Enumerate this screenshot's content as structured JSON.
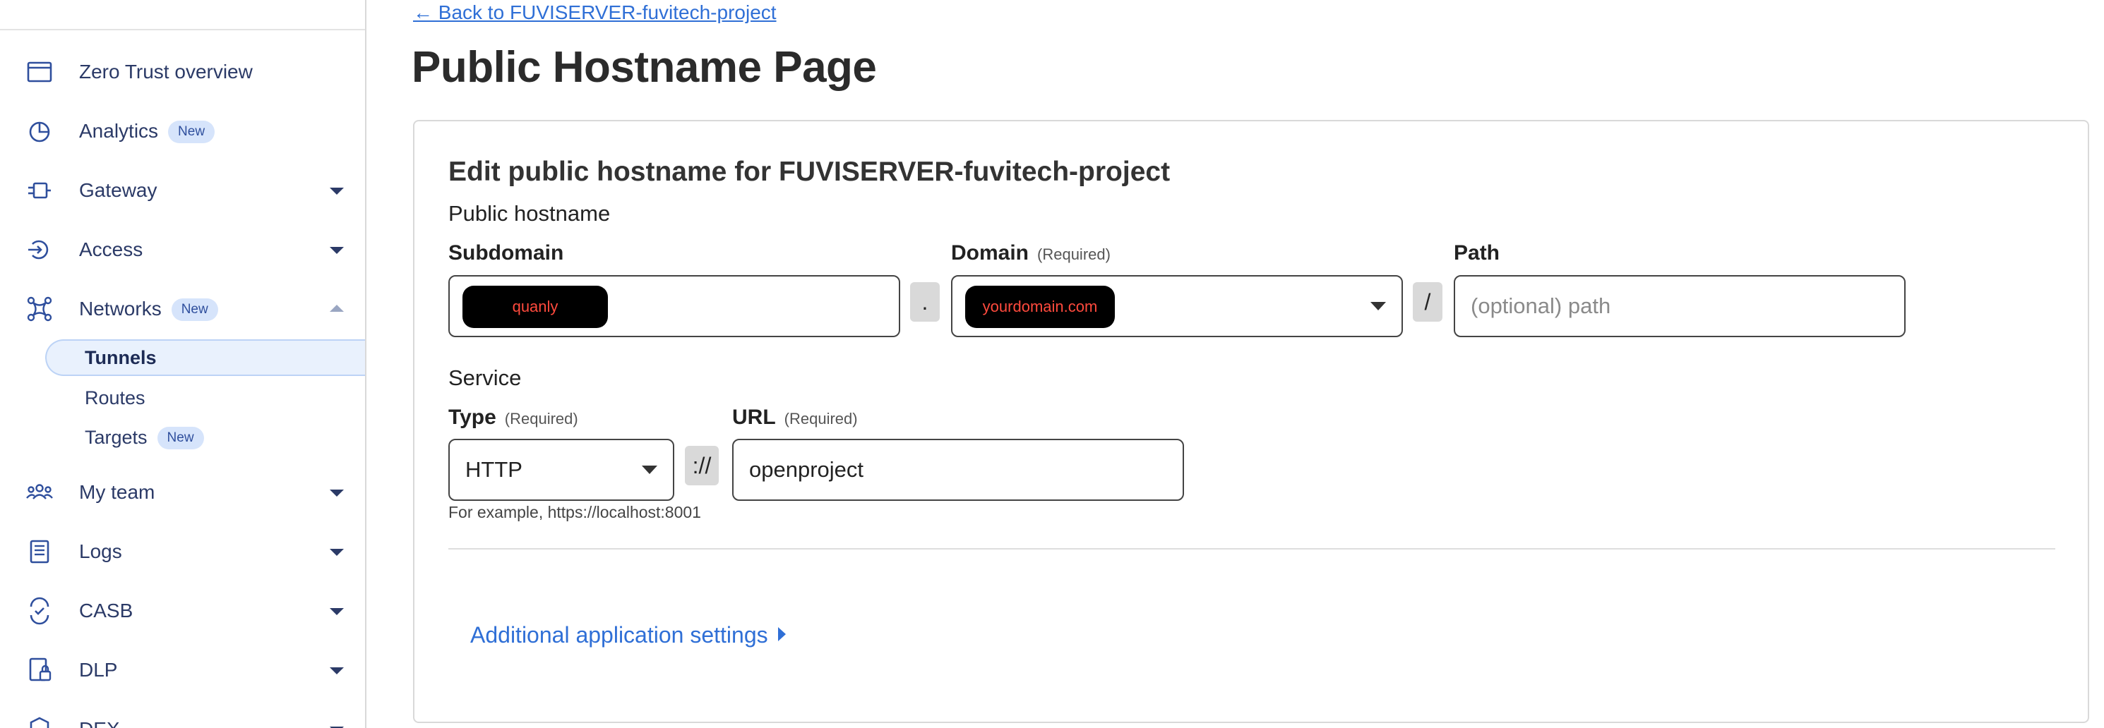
{
  "sidebar": {
    "items": [
      {
        "label": "Zero Trust overview",
        "icon": "browser-window-icon"
      },
      {
        "label": "Analytics",
        "badge": "New",
        "icon": "pie-chart-icon"
      },
      {
        "label": "Gateway",
        "icon": "gateway-icon"
      },
      {
        "label": "Access",
        "icon": "access-icon"
      },
      {
        "label": "Networks",
        "badge": "New",
        "icon": "network-icon"
      },
      {
        "label": "My team",
        "icon": "team-icon"
      },
      {
        "label": "Logs",
        "icon": "logs-icon"
      },
      {
        "label": "CASB",
        "icon": "casb-icon"
      },
      {
        "label": "DLP",
        "icon": "dlp-icon"
      },
      {
        "label": "DEX",
        "icon": "dex-icon"
      }
    ],
    "networks_sub": [
      {
        "label": "Tunnels",
        "active": true
      },
      {
        "label": "Routes"
      },
      {
        "label": "Targets",
        "badge": "New"
      }
    ]
  },
  "main": {
    "back_link": "← Back to FUVISERVER-fuvitech-project",
    "page_title": "Public Hostname Page",
    "card_title": "Edit public hostname for FUVISERVER-fuvitech-project",
    "public_hostname_label": "Public hostname",
    "subdomain": {
      "label": "Subdomain",
      "value": "quanly"
    },
    "domain": {
      "label": "Domain",
      "required": "(Required)",
      "value": "yourdomain.com"
    },
    "dot_separator": ".",
    "slash_separator": "/",
    "path": {
      "label": "Path",
      "placeholder": "(optional) path"
    },
    "service_label": "Service",
    "type": {
      "label": "Type",
      "required": "(Required)",
      "value": "HTTP"
    },
    "scheme_separator": "://",
    "url": {
      "label": "URL",
      "required": "(Required)",
      "value": "openproject"
    },
    "hint": "For example, https://localhost:8001",
    "additional_settings": "Additional application settings"
  },
  "colors": {
    "accent": "#2f6fd6",
    "nav_text": "#2b3a67",
    "badge_bg": "#d6e4fb",
    "pill_bg": "#000000",
    "pill_text": "#ff4a3d"
  }
}
